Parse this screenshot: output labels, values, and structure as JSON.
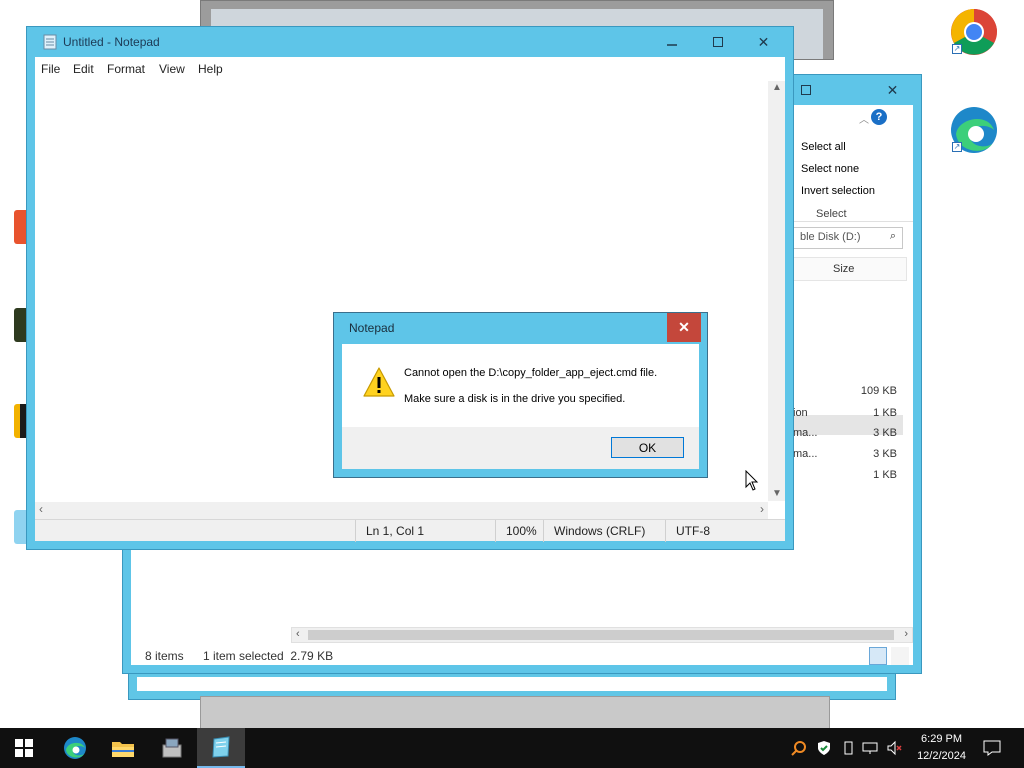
{
  "notepad": {
    "title": "Untitled - Notepad",
    "menu": [
      "File",
      "Edit",
      "Format",
      "View",
      "Help"
    ],
    "status": {
      "position": "Ln 1, Col 1",
      "zoom": "100%",
      "line_ending": "Windows (CRLF)",
      "encoding": "UTF-8"
    }
  },
  "dialog": {
    "title": "Notepad",
    "message_line1": "Cannot open the D:\\copy_folder_app_eject.cmd file.",
    "message_line2": "Make sure a disk is in the drive you specified.",
    "ok_label": "OK",
    "icon": "warning-icon"
  },
  "explorer": {
    "ribbon": {
      "select_all": "Select all",
      "select_none": "Select none",
      "invert_selection": "Invert selection",
      "group_label": "Select"
    },
    "search_placeholder": "ble Disk (D:)",
    "column_size": "Size",
    "rows": [
      {
        "name": "",
        "size": "109 KB"
      },
      {
        "name": "ion",
        "size": "1 KB"
      },
      {
        "name": "ma...",
        "size": "3 KB"
      },
      {
        "name": "ma...",
        "size": "3 KB"
      },
      {
        "name": "",
        "size": "1 KB"
      }
    ],
    "status_items": "8 items",
    "status_selected": "1 item selected  2.79 KB"
  },
  "taskbar": {
    "time": "6:29 PM",
    "date": "12/2/2024"
  },
  "colors": {
    "window_frame": "#5ec5e8",
    "close_red": "#c4473b",
    "taskbar": "#101010",
    "accent": "#0078d7"
  }
}
